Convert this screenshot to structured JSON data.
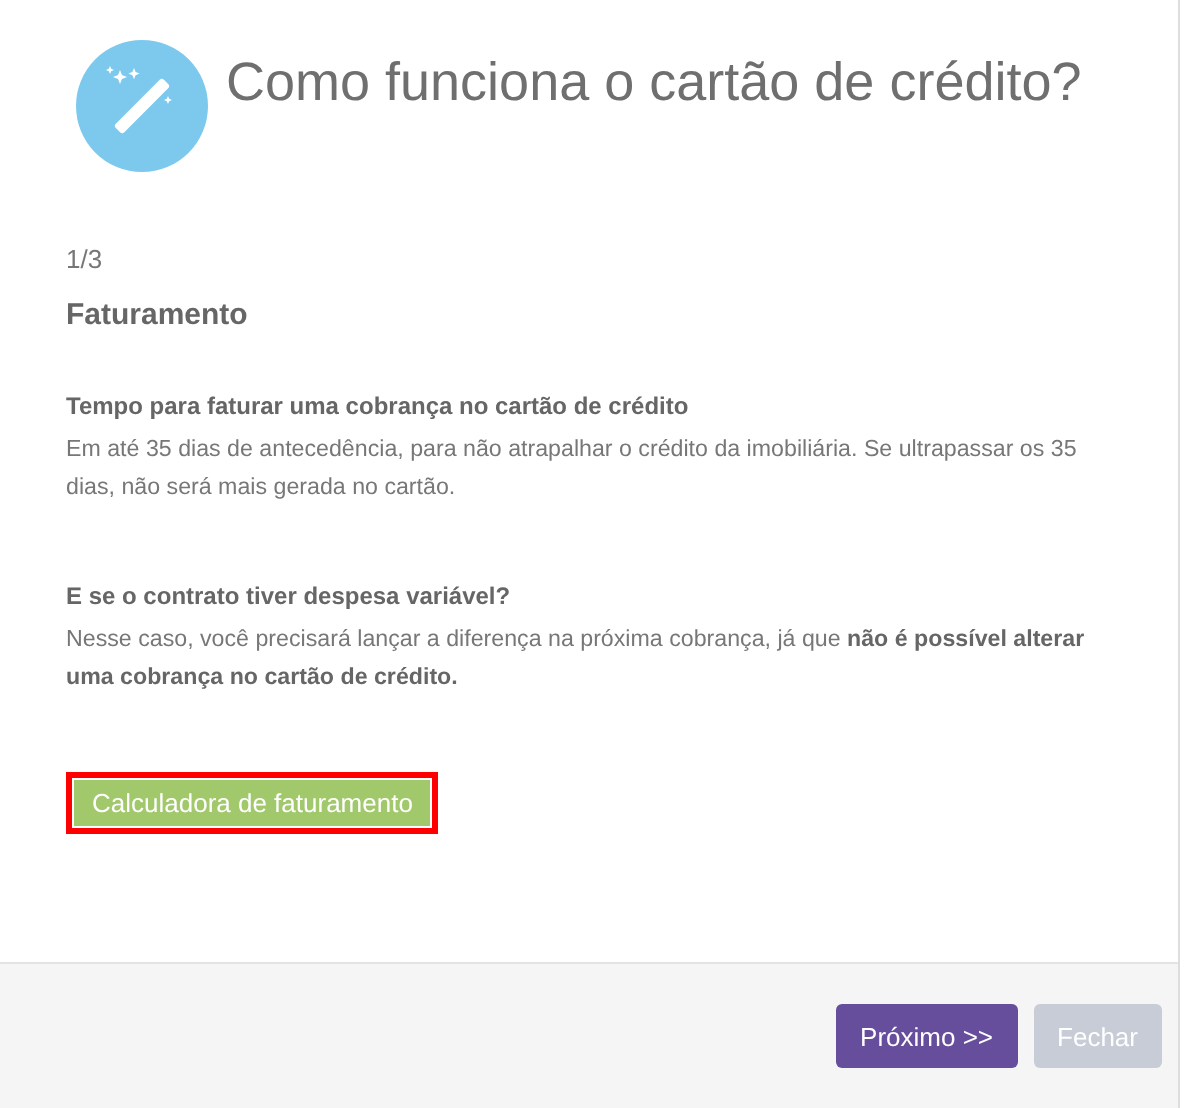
{
  "dialog": {
    "title": "Como funciona o cartão de crédito?"
  },
  "step": "1/3",
  "heading": "Faturamento",
  "sections": [
    {
      "title": "Tempo para faturar uma cobrança no cartão de crédito",
      "text": "Em até 35 dias de antecedência, para não atrapalhar o crédito da imobiliária. Se ultrapassar os 35 dias, não será mais gerada no cartão."
    },
    {
      "title": "E se o contrato tiver despesa variável?",
      "text": "Nesse caso, você precisará lançar a diferença na próxima cobrança, já que **não é possível alterar uma cobrança no cartão de crédito.**"
    }
  ],
  "action_button": {
    "label": "Calculadora de faturamento",
    "highlighted": true
  },
  "footer_buttons": [
    {
      "label": "Próximo >>",
      "kind": "primary",
      "disabled": false
    },
    {
      "label": "Fechar",
      "kind": "secondary",
      "disabled": true
    }
  ]
}
